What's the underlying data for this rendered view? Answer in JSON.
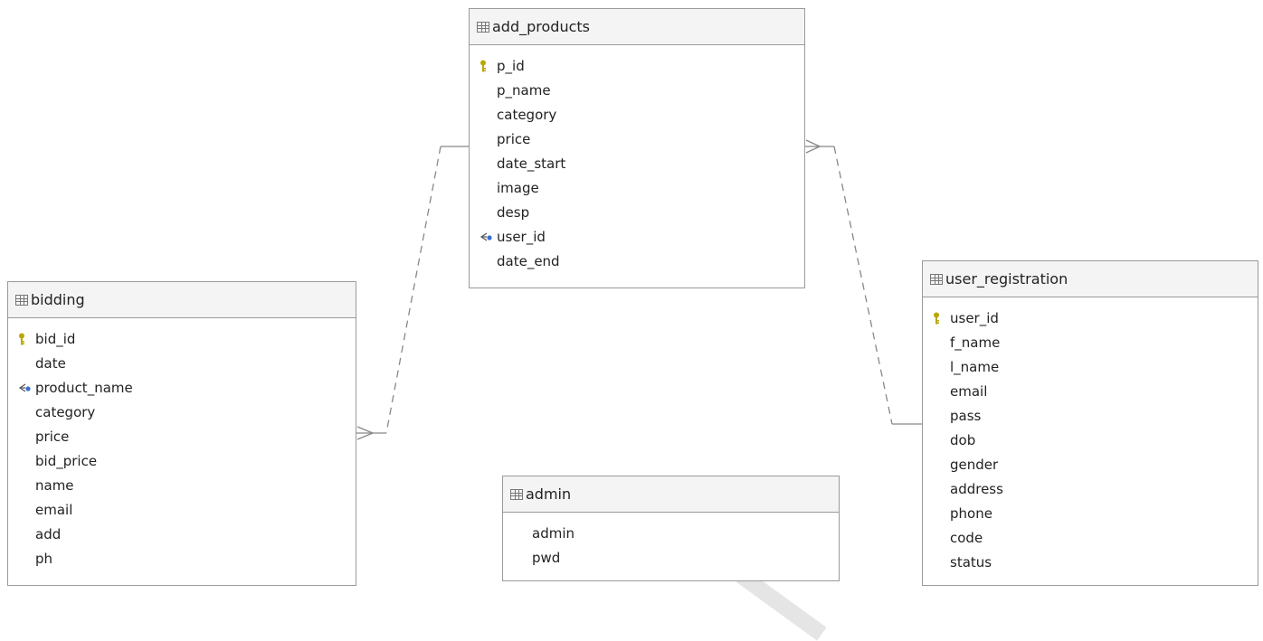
{
  "tables": {
    "add_products": {
      "name": "add_products",
      "columns": [
        {
          "name": "p_id",
          "key": "pk"
        },
        {
          "name": "p_name",
          "key": ""
        },
        {
          "name": "category",
          "key": ""
        },
        {
          "name": "price",
          "key": ""
        },
        {
          "name": "date_start",
          "key": ""
        },
        {
          "name": "image",
          "key": ""
        },
        {
          "name": "desp",
          "key": ""
        },
        {
          "name": "user_id",
          "key": "fk"
        },
        {
          "name": "date_end",
          "key": ""
        }
      ]
    },
    "bidding": {
      "name": "bidding",
      "columns": [
        {
          "name": "bid_id",
          "key": "pk"
        },
        {
          "name": "date",
          "key": ""
        },
        {
          "name": "product_name",
          "key": "fk"
        },
        {
          "name": "category",
          "key": ""
        },
        {
          "name": "price",
          "key": ""
        },
        {
          "name": "bid_price",
          "key": ""
        },
        {
          "name": "name",
          "key": ""
        },
        {
          "name": "email",
          "key": ""
        },
        {
          "name": "add",
          "key": ""
        },
        {
          "name": "ph",
          "key": ""
        }
      ]
    },
    "user_registration": {
      "name": "user_registration",
      "columns": [
        {
          "name": "user_id",
          "key": "pk"
        },
        {
          "name": "f_name",
          "key": ""
        },
        {
          "name": "l_name",
          "key": ""
        },
        {
          "name": "email",
          "key": ""
        },
        {
          "name": "pass",
          "key": ""
        },
        {
          "name": "dob",
          "key": ""
        },
        {
          "name": "gender",
          "key": ""
        },
        {
          "name": "address",
          "key": ""
        },
        {
          "name": "phone",
          "key": ""
        },
        {
          "name": "code",
          "key": ""
        },
        {
          "name": "status",
          "key": ""
        }
      ]
    },
    "admin": {
      "name": "admin",
      "columns": [
        {
          "name": "admin",
          "key": ""
        },
        {
          "name": "pwd",
          "key": ""
        }
      ]
    }
  },
  "relationships": [
    {
      "from": "add_products.p_id",
      "to": "bidding.product_name",
      "many_side": "bidding"
    },
    {
      "from": "user_registration.user_id",
      "to": "add_products.user_id",
      "many_side": "add_products"
    }
  ],
  "colors": {
    "border": "#9a9a9a",
    "header_bg": "#f4f4f4",
    "pk_key": "#b8a800",
    "fk_blue": "#3a6fd0",
    "relation_line": "#888888"
  },
  "icons": {
    "table": "table-grid-icon",
    "primary_key": "key-icon",
    "foreign_key": "foreign-key-icon"
  }
}
